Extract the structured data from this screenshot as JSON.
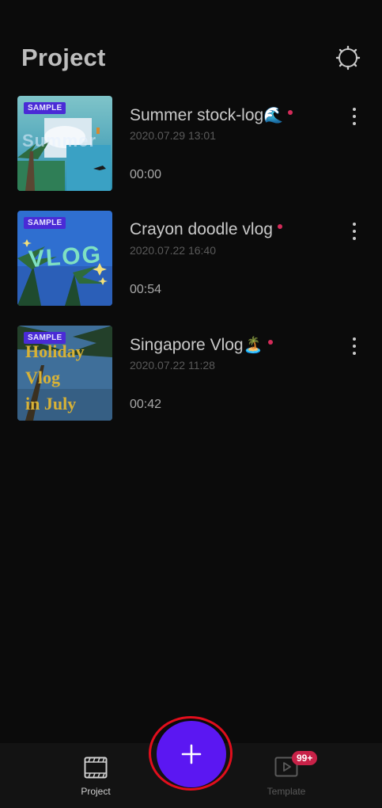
{
  "header": {
    "title": "Project"
  },
  "projects": [
    {
      "sample_label": "SAMPLE",
      "name": "Summer stock-log",
      "emoji": "🌊",
      "date": "2020.07.29 13:01",
      "duration": "00:00",
      "thumb_text": "Summer"
    },
    {
      "sample_label": "SAMPLE",
      "name": "Crayon doodle vlog",
      "emoji": "",
      "date": "2020.07.22 16:40",
      "duration": "00:54",
      "thumb_text": "VLOG"
    },
    {
      "sample_label": "SAMPLE",
      "name": "Singapore Vlog",
      "emoji": "🏝️",
      "date": "2020.07.22 11:28",
      "duration": "00:42",
      "thumb_text": [
        "Holiday",
        "Vlog",
        "in July"
      ]
    }
  ],
  "bottom_nav": {
    "project_label": "Project",
    "template_label": "Template",
    "template_badge": "99+"
  },
  "colors": {
    "accent": "#5b17f2",
    "highlight_ring": "#e10e1c",
    "unread_dot": "#d42b59",
    "sample_badge": "#4a2bd6"
  },
  "icons": [
    "gear-icon",
    "more-vertical-icon",
    "film-icon",
    "play-square-icon",
    "plus-icon"
  ]
}
